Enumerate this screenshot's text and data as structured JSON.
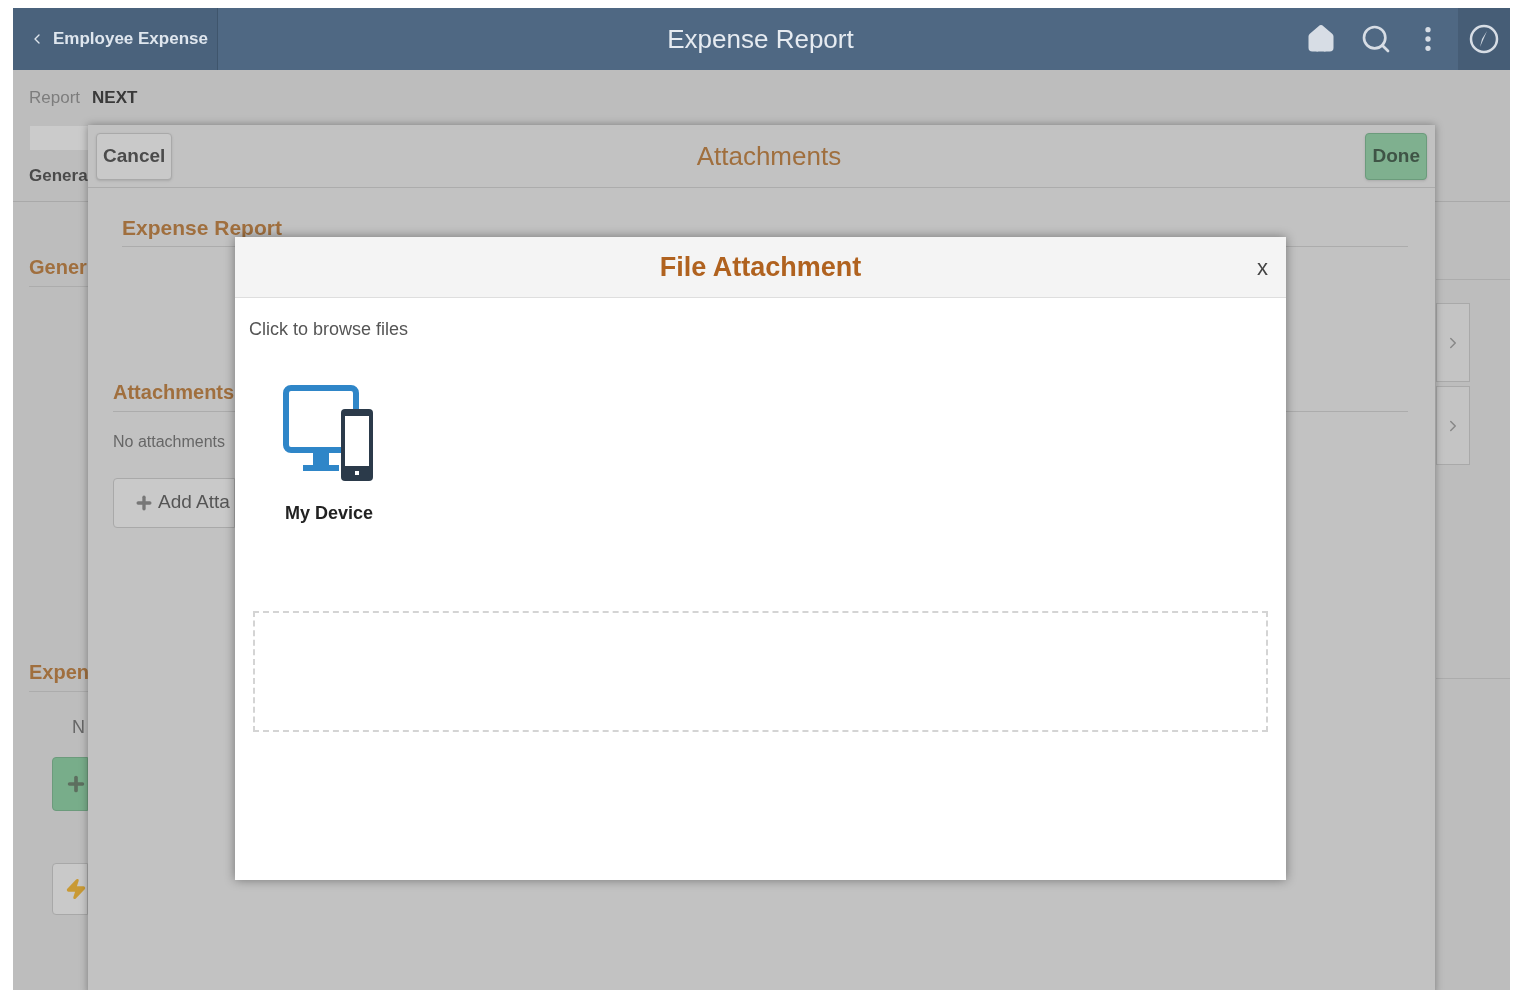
{
  "header": {
    "back_label": "Employee Expense",
    "title": "Expense Report"
  },
  "background": {
    "report_label": "Report",
    "report_value": "NEXT",
    "tab": "Genera",
    "section_1": "Gener",
    "section_2": "Expen",
    "text": "N"
  },
  "attachments_modal": {
    "cancel": "Cancel",
    "title": "Attachments",
    "done": "Done",
    "section": "Expense Report",
    "attachments_heading": "Attachments",
    "empty_text": "No attachments",
    "add_button": "Add Atta"
  },
  "file_dialog": {
    "title": "File Attachment",
    "close": "x",
    "instruction": "Click to browse files",
    "sources": [
      {
        "label": "My Device"
      }
    ]
  }
}
